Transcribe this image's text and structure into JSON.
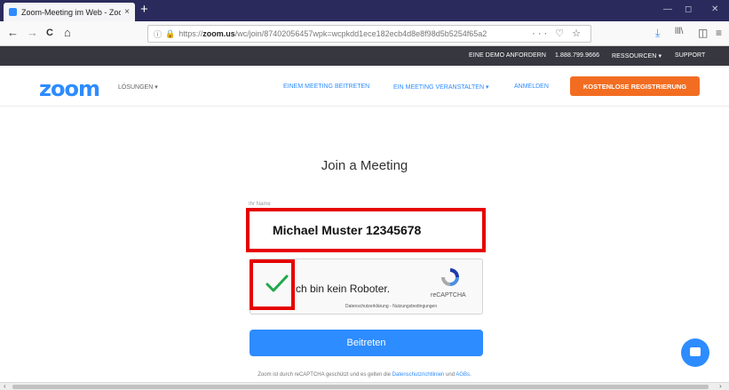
{
  "browser": {
    "tab_title": "Zoom-Meeting im Web - Zoom",
    "tab_close": "×",
    "new_tab": "+",
    "url_prefix": "https://",
    "url_domain": "zoom.us",
    "url_path": "/wc/join/87402056457wpk=wcpkdd1ece182ecb4d8e8f98d5b5254f65a2",
    "url_info_icon": "info-icon",
    "url_lock_icon": "lock-icon",
    "url_actions": "··· ♡ ☆",
    "nav_back": "←",
    "nav_forward": "→",
    "nav_reload": "C",
    "nav_home": "⌂",
    "toolbar_download": "⤓",
    "toolbar_library": "lll\\",
    "toolbar_sidebar": "◫",
    "toolbar_menu": "≡",
    "win_min": "—",
    "win_max": "◻",
    "win_close": "✕"
  },
  "zoom_top": {
    "demo": "EINE DEMO ANFORDERN",
    "phone": "1.888.799.9666",
    "resources": "RESSOURCEN ▾",
    "support": "SUPPORT"
  },
  "zoom_header": {
    "logo": "zoom",
    "solutions": "LÖSUNGEN ▾",
    "join_meeting": "EINEM MEETING BEITRETEN",
    "host_meeting": "EIN MEETING VERANSTALTEN ▾",
    "sign_in": "ANMELDEN",
    "signup": "KOSTENLOSE REGISTRIERUNG"
  },
  "join": {
    "title": "Join a Meeting",
    "name_label": "Ihr Name",
    "name_value": "Michael Muster 12345678",
    "captcha_text": "ch bin kein Roboter.",
    "recaptcha_label": "reCAPTCHA",
    "recaptcha_links": "Datenschutzerklärung - Nutzungsbedingungen",
    "join_button": "Beitreten",
    "footer_text": "Zoom ist durch reCAPTCHA geschützt und es gelten die ",
    "footer_privacy": "Datenschutzrichtlinien",
    "footer_and": " und ",
    "footer_terms": "AGBs",
    "footer_end": "."
  },
  "colors": {
    "zoom_blue": "#2d8cff",
    "signup_orange": "#f26d21",
    "highlight_red": "#e60000",
    "check_green": "#1fa84a"
  }
}
